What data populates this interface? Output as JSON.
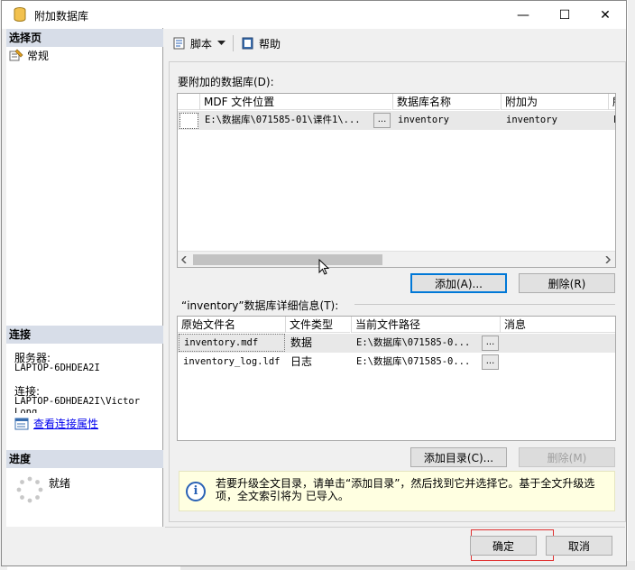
{
  "window": {
    "title": "附加数据库",
    "minimize_glyph": "—",
    "maximize_glyph": "☐",
    "close_glyph": "✕"
  },
  "left": {
    "select_page_header": "选择页",
    "nav_items": [
      {
        "label": "常规",
        "icon": "general-page-icon"
      }
    ],
    "connection_header": "连接",
    "server_label": "服务器:",
    "server_value": "LAPTOP-6DHDEA2I",
    "connection_label": "连接:",
    "connection_value": "LAPTOP-6DHDEA2I\\Victor",
    "connection_value_cont": "Long",
    "view_link": "查看连接属性",
    "progress_header": "进度",
    "status": "就绪"
  },
  "toolbar": {
    "script_label": "脚本",
    "help_label": "帮助"
  },
  "attach": {
    "label": "要附加的数据库(D):",
    "columns": [
      "MDF 文件位置",
      "数据库名称",
      "附加为",
      "所"
    ],
    "rows": [
      {
        "mdf": "E:\\数据库\\071585-01\\课件1\\...",
        "db_name": "inventory",
        "attach_as": "inventory",
        "owner": "L"
      }
    ],
    "add_button": "添加(A)...",
    "remove_button": "删除(R)"
  },
  "details": {
    "label": "“inventory”数据库详细信息(T):",
    "columns": [
      "原始文件名",
      "文件类型",
      "当前文件路径",
      "消息"
    ],
    "rows": [
      {
        "file": "inventory.mdf",
        "type": "数据",
        "path": "E:\\数据库\\071585-0..."
      },
      {
        "file": "inventory_log.ldf",
        "type": "日志",
        "path": "E:\\数据库\\071585-0..."
      }
    ],
    "add_catalog_button": "添加目录(C)...",
    "remove_button": "删除(M)"
  },
  "info": {
    "icon": "info-icon",
    "text": "若要升级全文目录，请单击“添加目录”，然后找到它并选择它。基于全文升级选项，全文索引将为 已导入。"
  },
  "footer": {
    "ok_button": "确定",
    "cancel_button": "取消"
  },
  "colors": {
    "section_header_bg": "#d7dde8",
    "info_bg": "#ffffe1",
    "highlight_border": "#e03030",
    "primary_border": "#0078d7"
  }
}
